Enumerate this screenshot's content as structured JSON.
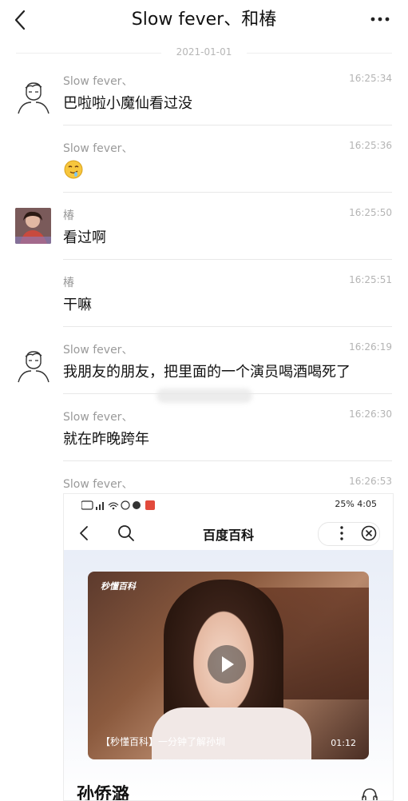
{
  "header": {
    "title": "Slow fever、和椿"
  },
  "date_separator": "2021-01-01",
  "messages": [
    {
      "sender": "Slow fever、",
      "time": "16:25:34",
      "text": "巴啦啦小魔仙看过没"
    },
    {
      "sender": "Slow fever、",
      "time": "16:25:36",
      "emoji": "drooling-face-icon"
    },
    {
      "sender": "椿",
      "time": "16:25:50",
      "text": "看过啊"
    },
    {
      "sender": "椿",
      "time": "16:25:51",
      "text": "干嘛"
    },
    {
      "sender": "Slow fever、",
      "time": "16:26:19",
      "text": "我朋友的朋友，把里面的一个演员喝酒喝死了"
    },
    {
      "sender": "Slow fever、",
      "time": "16:26:30",
      "text": "就在昨晚跨年"
    },
    {
      "sender": "Slow fever、",
      "time": "16:26:53"
    }
  ],
  "screenshot": {
    "status_right": "25%  4:05",
    "nav_title": "百度百科",
    "video_logo": "秒懂百科",
    "video_caption": "【秒懂百科】一分钟了解孙圳",
    "video_duration": "01:12",
    "entry_name": "孙侨潞"
  }
}
